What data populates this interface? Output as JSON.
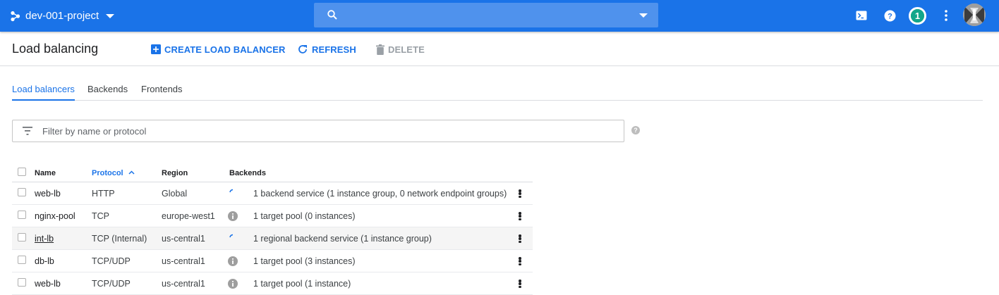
{
  "appbar": {
    "project_name": "dev-001-project",
    "search_placeholder": "",
    "notification_count": "1"
  },
  "toolbar": {
    "title": "Load balancing",
    "create_label": "CREATE LOAD BALANCER",
    "refresh_label": "REFRESH",
    "delete_label": "DELETE"
  },
  "tabs": [
    {
      "label": "Load balancers",
      "active": true
    },
    {
      "label": "Backends",
      "active": false
    },
    {
      "label": "Frontends",
      "active": false
    }
  ],
  "filter": {
    "placeholder": "Filter by name or protocol"
  },
  "table": {
    "headers": {
      "name": "Name",
      "protocol": "Protocol",
      "region": "Region",
      "backends": "Backends"
    },
    "rows": [
      {
        "name": "web-lb",
        "protocol": "HTTP",
        "region": "Global",
        "backends": "1 backend service (1 instance group, 0 network endpoint groups)",
        "icon": "spinner-icon"
      },
      {
        "name": "nginx-pool",
        "protocol": "TCP",
        "region": "europe-west1",
        "backends": "1 target pool (0 instances)",
        "icon": "info-icon"
      },
      {
        "name": "int-lb",
        "protocol": "TCP (Internal)",
        "region": "us-central1",
        "backends": "1 regional backend service (1 instance group)",
        "icon": "spinner-icon"
      },
      {
        "name": "db-lb",
        "protocol": "TCP/UDP",
        "region": "us-central1",
        "backends": "1 target pool (3 instances)",
        "icon": "info-icon"
      },
      {
        "name": "web-lb",
        "protocol": "TCP/UDP",
        "region": "us-central1",
        "backends": "1 target pool (1 instance)",
        "icon": "info-icon"
      }
    ]
  },
  "colors": {
    "primary": "#1a73e8",
    "badge": "#12a68a"
  }
}
